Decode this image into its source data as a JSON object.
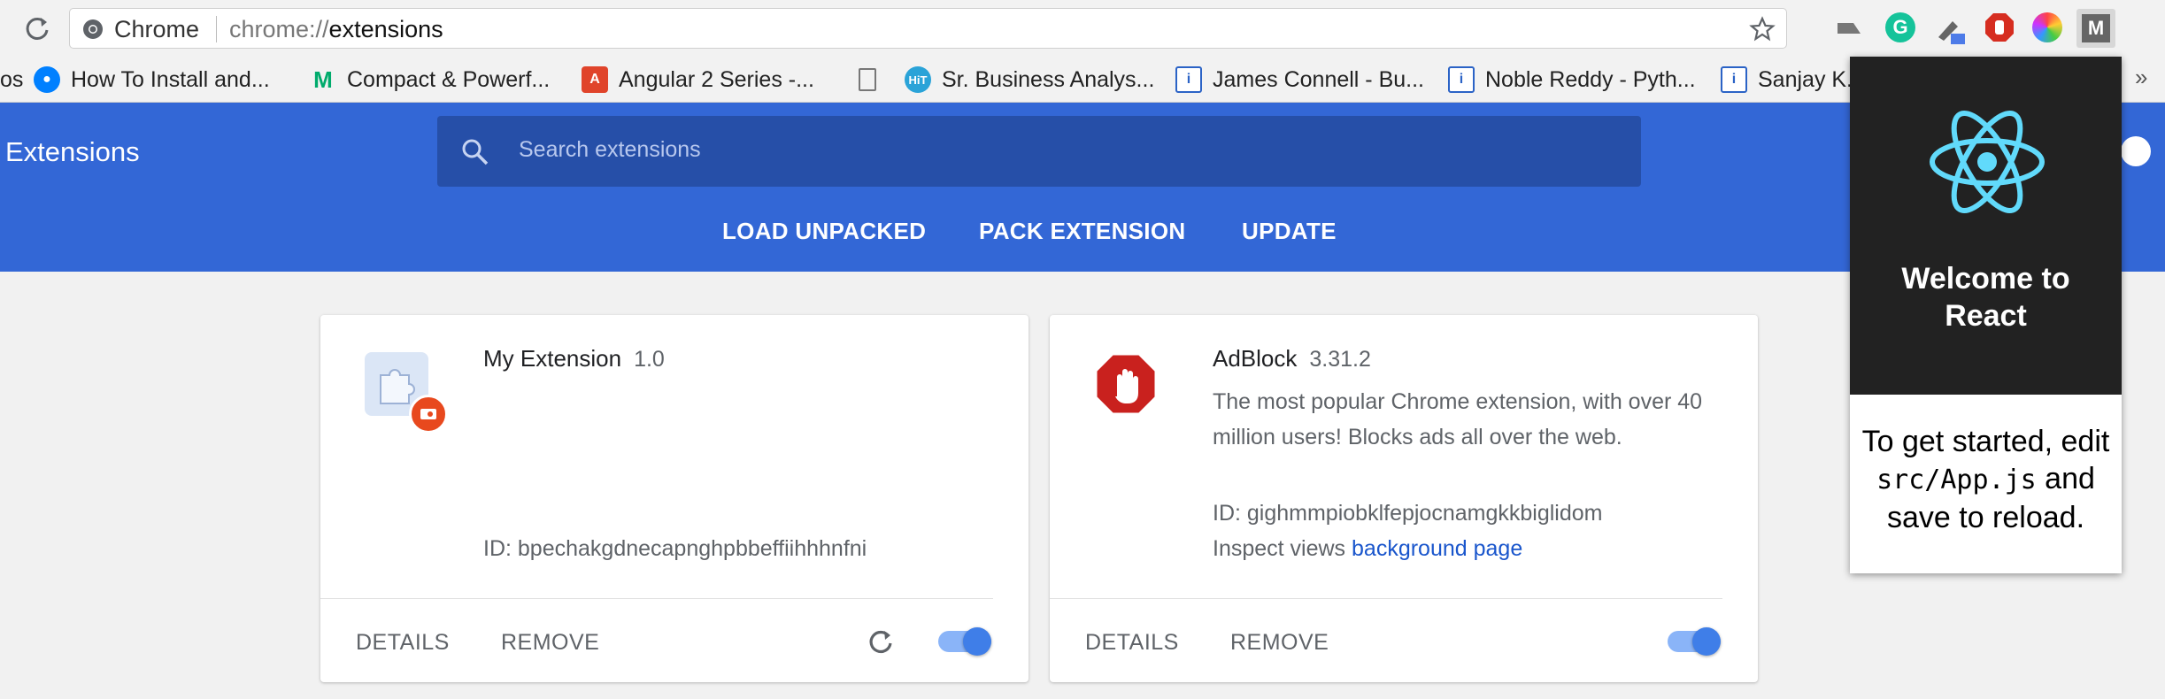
{
  "browser": {
    "title": "Chrome",
    "url_scheme": "chrome://",
    "url_path": "extensions"
  },
  "bookmarks": [
    {
      "label": "How To Install and...",
      "icon": "digitalocean-icon",
      "color": "#0080ff"
    },
    {
      "label": "Compact & Powerf...",
      "icon": "medium-icon",
      "color": "#00ab6c"
    },
    {
      "label": "Angular 2 Series -...",
      "icon": "angular-icon",
      "color": "#e0442b"
    },
    {
      "label": "Sr. Business Analys...",
      "icon": "hit-icon",
      "color": "#2aa3d8"
    },
    {
      "label": "James Connell - Bu...",
      "icon": "info-icon",
      "color": "#2b63c6"
    },
    {
      "label": "Noble Reddy - Pyth...",
      "icon": "info-icon",
      "color": "#2b63c6"
    },
    {
      "label": "Sanjay K.",
      "icon": "info-icon",
      "color": "#2b63c6"
    }
  ],
  "bookmarks_left_fragment": "os",
  "header": {
    "title": "Extensions",
    "search_placeholder": "Search extensions",
    "buttons": [
      "LOAD UNPACKED",
      "PACK EXTENSION",
      "UPDATE"
    ]
  },
  "extensions": [
    {
      "name": "My Extension",
      "version": "1.0",
      "description": "",
      "id_text": "ID: bpechakgdnecapnghpbbeffiihhhnfni",
      "details_label": "DETAILS",
      "remove_label": "REMOVE",
      "enabled": true
    },
    {
      "name": "AdBlock",
      "version": "3.31.2",
      "description_line1": "The most popular Chrome extension, with over 40",
      "description_line2": "million users! Blocks ads all over the web.",
      "id_text": "ID: gighmmpiobklfepjocnamgkkbiglidom",
      "inspect_label": "Inspect views",
      "inspect_link": "background page",
      "details_label": "DETAILS",
      "remove_label": "REMOVE",
      "enabled": true
    }
  ],
  "popup": {
    "welcome_line1": "Welcome to",
    "welcome_line2": "React",
    "body_pre": "To get started, edit",
    "body_code": "src/App.js",
    "body_and": "and",
    "body_post": "save to reload."
  },
  "colors": {
    "header_blue": "#3367d6",
    "search_blue": "#264fa8",
    "react_cyan": "#61dafb",
    "link_blue": "#1a56cc"
  }
}
